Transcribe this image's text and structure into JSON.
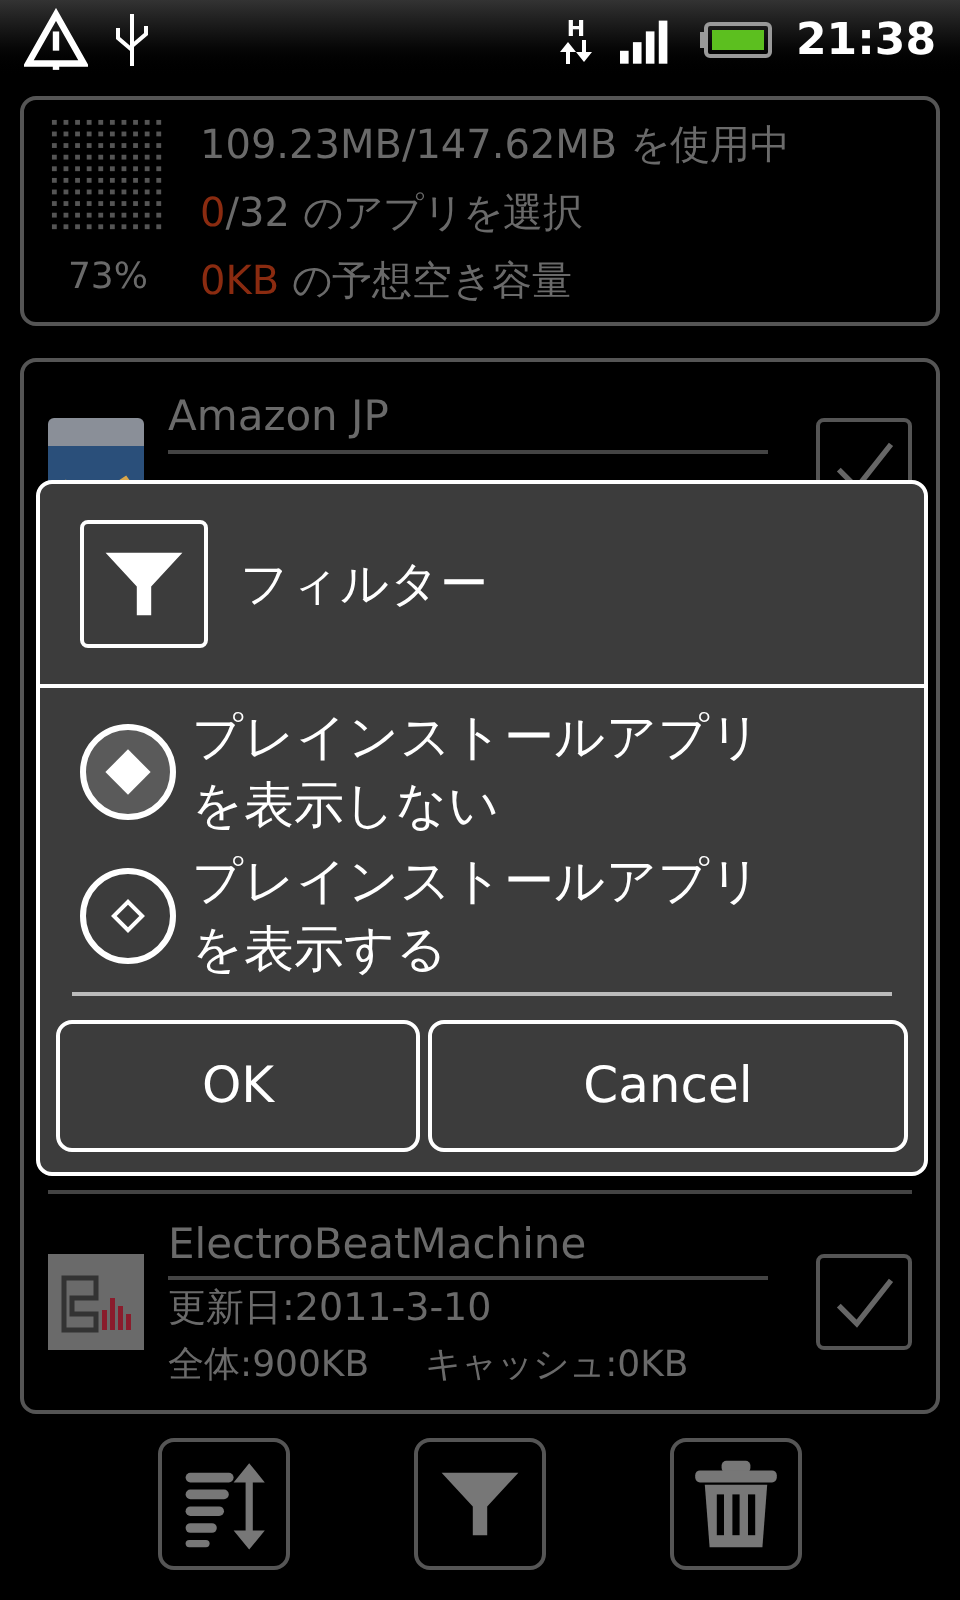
{
  "status_bar": {
    "time": "21:38",
    "network": "H"
  },
  "summary": {
    "percent": "73%",
    "lines": [
      {
        "text": "109.23MB/147.62MB を使用中"
      },
      {
        "highlight": "0",
        "text": "/32 のアプリを選択"
      },
      {
        "highlight": "0KB",
        "text": " の予想空き容量"
      }
    ]
  },
  "apps": [
    {
      "name": "Amazon JP",
      "checked": true
    },
    {
      "name": "ElectroBeatMachine",
      "updated": "更新日:2011-3-10",
      "size": "全体:900KB",
      "cache": "キャッシュ:0KB",
      "checked": true
    }
  ],
  "dialog": {
    "title": "フィルター",
    "options": [
      {
        "label": "プレインストールアプリを表示しない",
        "selected": true
      },
      {
        "label": "プレインストールアプリを表示する",
        "selected": false
      }
    ],
    "buttons": [
      "OK",
      "Cancel"
    ]
  },
  "toolbar": [
    {
      "kind": "sort"
    },
    {
      "kind": "filter"
    },
    {
      "kind": "delete"
    }
  ]
}
